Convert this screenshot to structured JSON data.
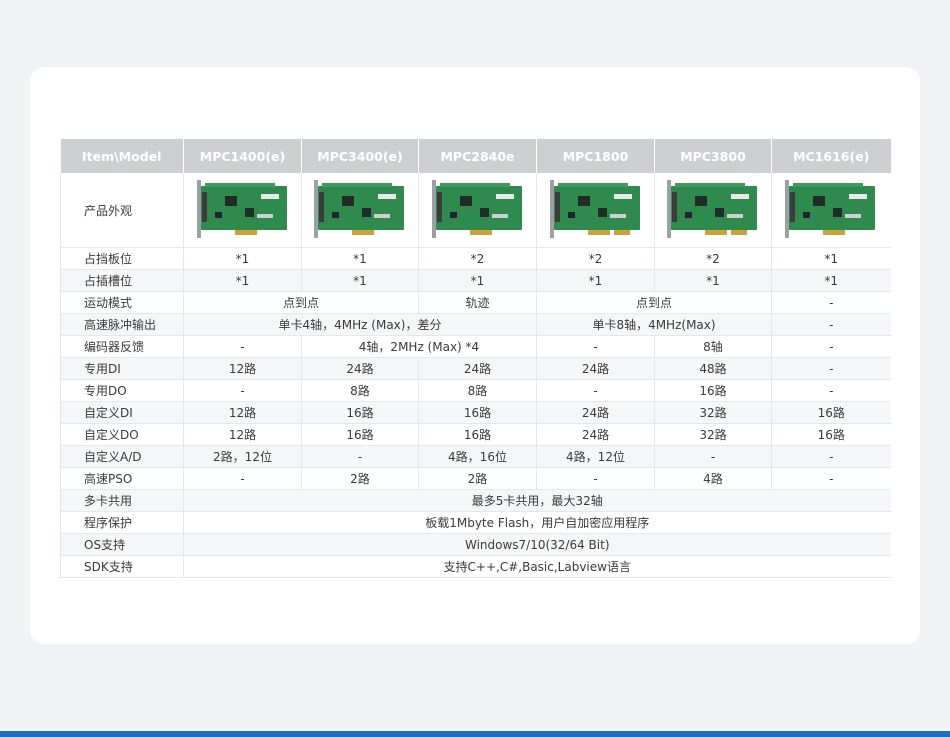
{
  "table": {
    "header_label": "Item\\Model",
    "models": [
      "MPC1400(e)",
      "MPC3400(e)",
      "MPC2840e",
      "MPC1800",
      "MPC3800",
      "MC1616(e)"
    ],
    "appearance_label": "产品外观",
    "rows": [
      {
        "label": "占挡板位",
        "cells": [
          {
            "v": "*1",
            "span": 1
          },
          {
            "v": "*1",
            "span": 1
          },
          {
            "v": "*2",
            "span": 1
          },
          {
            "v": "*2",
            "span": 1
          },
          {
            "v": "*2",
            "span": 1
          },
          {
            "v": "*1",
            "span": 1
          }
        ]
      },
      {
        "label": "占插槽位",
        "cells": [
          {
            "v": "*1",
            "span": 1
          },
          {
            "v": "*1",
            "span": 1
          },
          {
            "v": "*1",
            "span": 1
          },
          {
            "v": "*1",
            "span": 1
          },
          {
            "v": "*1",
            "span": 1
          },
          {
            "v": "*1",
            "span": 1
          }
        ]
      },
      {
        "label": "运动模式",
        "cells": [
          {
            "v": "点到点",
            "span": 2
          },
          {
            "v": "轨迹",
            "span": 1
          },
          {
            "v": "点到点",
            "span": 2
          },
          {
            "v": "-",
            "span": 1
          }
        ]
      },
      {
        "label": "高速脉冲输出",
        "cells": [
          {
            "v": "单卡4轴，4MHz (Max)，差分",
            "span": 3
          },
          {
            "v": "单卡8轴，4MHz(Max)",
            "span": 2
          },
          {
            "v": "-",
            "span": 1
          }
        ]
      },
      {
        "label": "编码器反馈",
        "cells": [
          {
            "v": "-",
            "span": 1
          },
          {
            "v": "4轴，2MHz (Max) *4",
            "span": 2
          },
          {
            "v": "-",
            "span": 1
          },
          {
            "v": "8轴",
            "span": 1
          },
          {
            "v": "-",
            "span": 1
          }
        ]
      },
      {
        "label": "专用DI",
        "cells": [
          {
            "v": "12路",
            "span": 1
          },
          {
            "v": "24路",
            "span": 1
          },
          {
            "v": "24路",
            "span": 1
          },
          {
            "v": "24路",
            "span": 1
          },
          {
            "v": "48路",
            "span": 1
          },
          {
            "v": "-",
            "span": 1
          }
        ]
      },
      {
        "label": "专用DO",
        "cells": [
          {
            "v": "-",
            "span": 1
          },
          {
            "v": "8路",
            "span": 1
          },
          {
            "v": "8路",
            "span": 1
          },
          {
            "v": "-",
            "span": 1
          },
          {
            "v": "16路",
            "span": 1
          },
          {
            "v": "-",
            "span": 1
          }
        ]
      },
      {
        "label": "自定义DI",
        "cells": [
          {
            "v": "12路",
            "span": 1
          },
          {
            "v": "16路",
            "span": 1
          },
          {
            "v": "16路",
            "span": 1
          },
          {
            "v": "24路",
            "span": 1
          },
          {
            "v": "32路",
            "span": 1
          },
          {
            "v": "16路",
            "span": 1
          }
        ]
      },
      {
        "label": "自定义DO",
        "cells": [
          {
            "v": "12路",
            "span": 1
          },
          {
            "v": "16路",
            "span": 1
          },
          {
            "v": "16路",
            "span": 1
          },
          {
            "v": "24路",
            "span": 1
          },
          {
            "v": "32路",
            "span": 1
          },
          {
            "v": "16路",
            "span": 1
          }
        ]
      },
      {
        "label": "自定义A/D",
        "cells": [
          {
            "v": "2路，12位",
            "span": 1
          },
          {
            "v": "-",
            "span": 1
          },
          {
            "v": "4路，16位",
            "span": 1
          },
          {
            "v": "4路，12位",
            "span": 1
          },
          {
            "v": "-",
            "span": 1
          },
          {
            "v": "-",
            "span": 1
          }
        ]
      },
      {
        "label": "高速PSO",
        "cells": [
          {
            "v": "-",
            "span": 1
          },
          {
            "v": "2路",
            "span": 1
          },
          {
            "v": "2路",
            "span": 1
          },
          {
            "v": "-",
            "span": 1
          },
          {
            "v": "4路",
            "span": 1
          },
          {
            "v": "-",
            "span": 1
          }
        ]
      },
      {
        "label": "多卡共用",
        "cells": [
          {
            "v": "最多5卡共用，最大32轴",
            "span": 6
          }
        ]
      },
      {
        "label": "程序保护",
        "cells": [
          {
            "v": "板载1Mbyte Flash，用户自加密应用程序",
            "span": 6
          }
        ]
      },
      {
        "label": "OS支持",
        "cells": [
          {
            "v": "Windows7/10(32/64 Bit)",
            "span": 6
          }
        ]
      },
      {
        "label": "SDK支持",
        "cells": [
          {
            "v": "支持C++,C#,Basic,Labview语言",
            "span": 6
          }
        ]
      }
    ]
  },
  "colors": {
    "header_bg": "#cdcfd1",
    "board_green": "#2f8a4e",
    "bracket_gray": "#9aa0a6",
    "accent_bar": "#1a6fbf"
  },
  "boards": [
    {
      "bracket": true,
      "pci_plus": false,
      "connector": true
    },
    {
      "bracket": true,
      "pci_plus": false,
      "connector": true
    },
    {
      "bracket": true,
      "pci_plus": false,
      "connector": true
    },
    {
      "bracket": true,
      "pci_plus": true,
      "connector": true
    },
    {
      "bracket": true,
      "pci_plus": true,
      "connector": true
    },
    {
      "bracket": true,
      "pci_plus": false,
      "connector": true
    }
  ]
}
